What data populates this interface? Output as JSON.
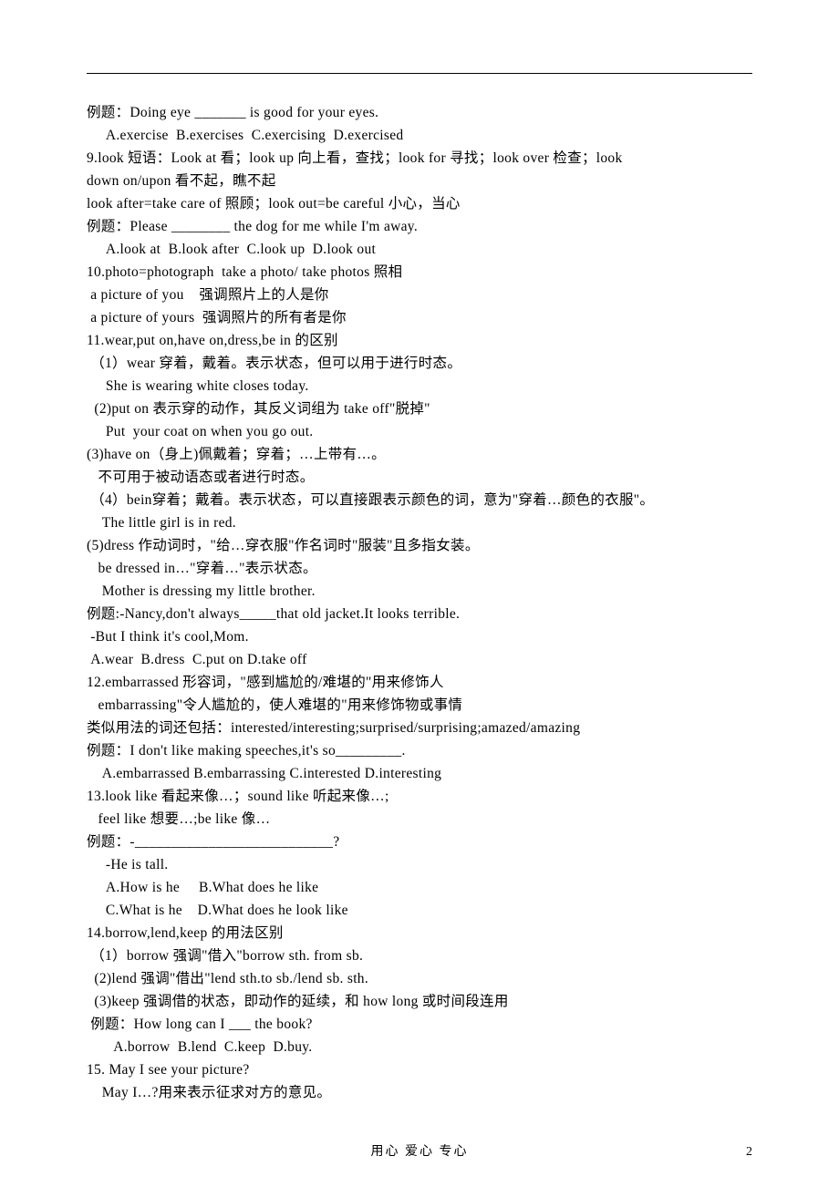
{
  "lines": [
    "例题：Doing eye _______ is good for your eyes.",
    "     A.exercise  B.exercises  C.exercising  D.exercised",
    "9.look 短语：Look at 看；look up 向上看，查找；look for 寻找；look over 检查；look",
    "down on/upon 看不起，瞧不起",
    "look after=take care of 照顾；look out=be careful 小心，当心",
    "例题：Please ________ the dog for me while I'm away.",
    "     A.look at  B.look after  C.look up  D.look out",
    "10.photo=photograph  take a photo/ take photos 照相",
    " a picture of you    强调照片上的人是你",
    " a picture of yours  强调照片的所有者是你",
    "11.wear,put on,have on,dress,be in 的区别",
    " （1）wear 穿着，戴着。表示状态，但可以用于进行时态。",
    "     She is wearing white closes today.",
    "  (2)put on 表示穿的动作，其反义词组为 take off\"脱掉\"",
    "     Put  your coat on when you go out.",
    "(3)have on（身上)佩戴着；穿着；…上带有…。",
    "   不可用于被动语态或者进行时态。",
    " （4）bein穿着；戴着。表示状态，可以直接跟表示颜色的词，意为\"穿着…颜色的衣服\"。",
    "    The little girl is in red.",
    "(5)dress 作动词时，\"给…穿衣服\"作名词时\"服装\"且多指女装。",
    "   be dressed in…\"穿着…\"表示状态。",
    "    Mother is dressing my little brother.",
    "例题:-Nancy,don't always_____that old jacket.It looks terrible.",
    " -But I think it's cool,Mom.",
    " A.wear  B.dress  C.put on D.take off",
    "12.embarrassed 形容词，\"感到尴尬的/难堪的\"用来修饰人",
    "   embarrassing\"令人尴尬的，使人难堪的\"用来修饰物或事情",
    "类似用法的词还包括：interested/interesting;surprised/surprising;amazed/amazing",
    "例题：I don't like making speeches,it's so_________.",
    "    A.embarrassed B.embarrassing C.interested D.interesting",
    "13.look like 看起来像…；sound like 听起来像…;",
    "   feel like 想要…;be like 像…",
    "例题：-___________________________?",
    "     -He is tall.",
    "     A.How is he     B.What does he like",
    "     C.What is he    D.What does he look like",
    "14.borrow,lend,keep 的用法区别",
    " （1）borrow 强调\"借入\"borrow sth. from sb.",
    "  (2)lend 强调\"借出\"lend sth.to sb./lend sb. sth.",
    "  (3)keep 强调借的状态，即动作的延续，和 how long 或时间段连用",
    " 例题：How long can I ___ the book?",
    "       A.borrow  B.lend  C.keep  D.buy.",
    "15. May I see your picture?",
    "    May I…?用来表示征求对方的意见。"
  ],
  "footer": {
    "motto": "用心  爱心  专心",
    "page_number": "2"
  }
}
